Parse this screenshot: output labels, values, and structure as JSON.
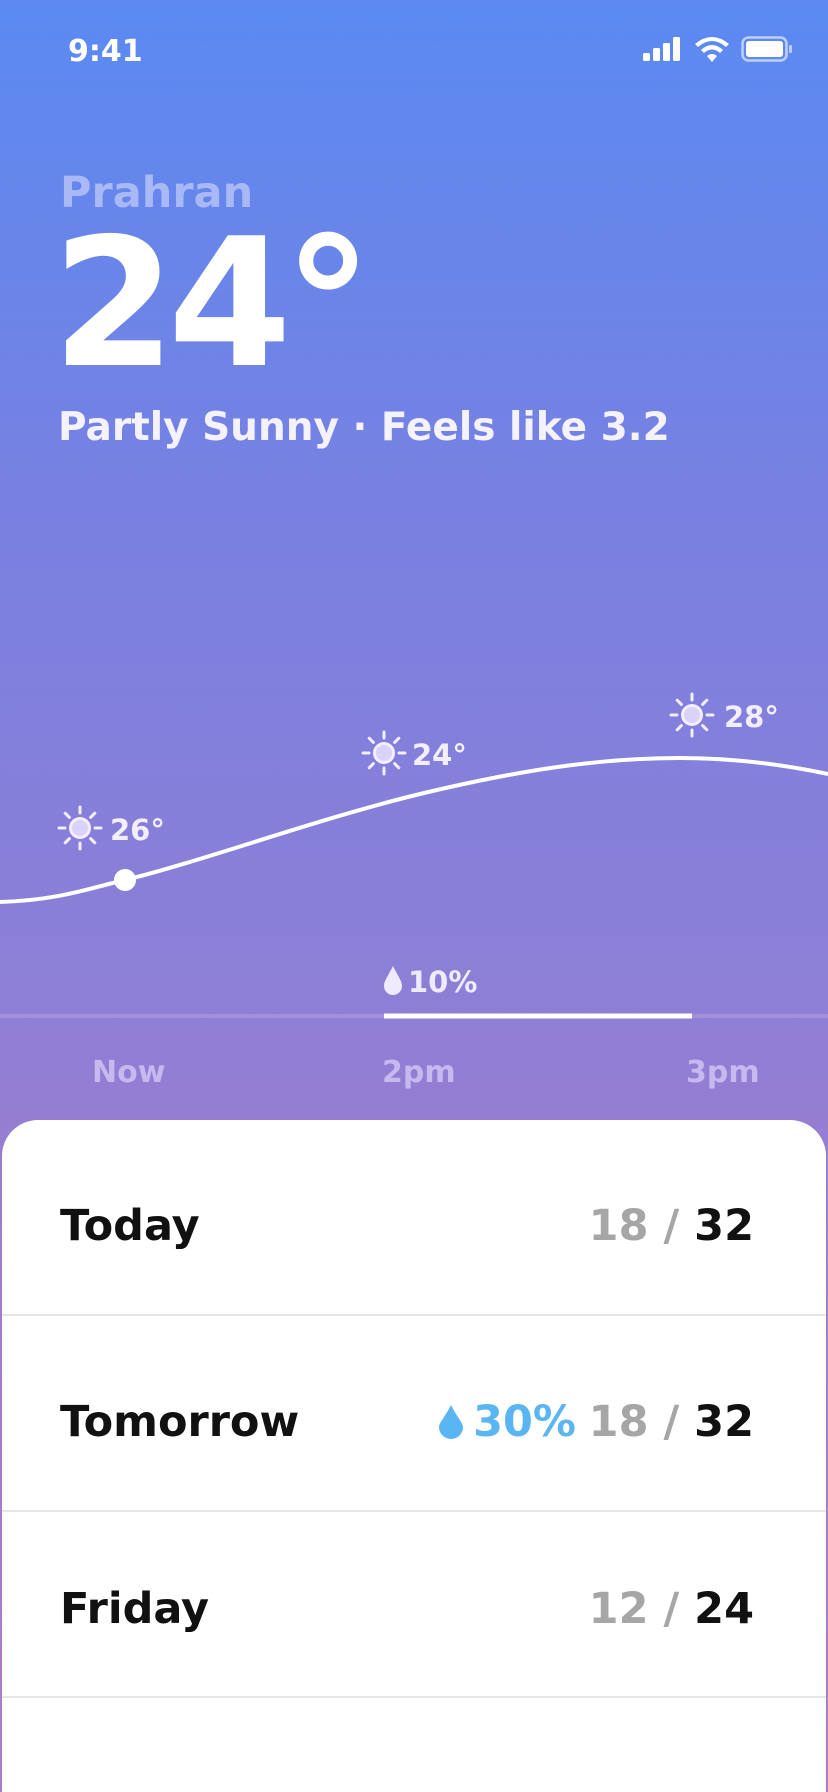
{
  "status_bar": {
    "time": "9:41"
  },
  "location": "Prahran",
  "current": {
    "temperature": "24°",
    "condition": "Partly Sunny · Feels like 3.2"
  },
  "hourly": {
    "points": [
      {
        "temp": "26°",
        "icon": "sun-icon"
      },
      {
        "temp": "24°",
        "icon": "sun-icon"
      },
      {
        "temp": "28°",
        "icon": "sun-icon"
      }
    ],
    "precipitation": "10%",
    "labels": [
      "Now",
      "2pm",
      "3pm"
    ]
  },
  "forecast": [
    {
      "day": "Today",
      "low": "18",
      "high": "32",
      "precip": ""
    },
    {
      "day": "Tomorrow",
      "low": "18",
      "high": "32",
      "precip": "30%"
    },
    {
      "day": "Friday",
      "low": "12",
      "high": "24",
      "precip": ""
    }
  ],
  "colors": {
    "precip_blue": "#5ab6f2",
    "sheet_background": "#ffffff"
  }
}
